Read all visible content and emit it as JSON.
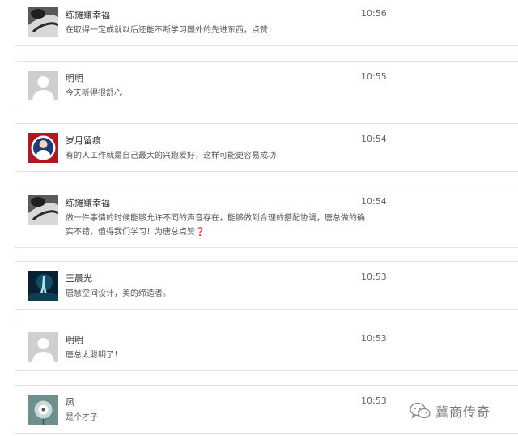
{
  "comments": [
    {
      "name": "练摊赚幸福",
      "time": "10:56",
      "text": "在取得一定成就以后还能不断学习国外的先进东西，点赞！",
      "avatar": "hand-photo-avatar"
    },
    {
      "name": "明明",
      "time": "10:55",
      "text": "今天听得很舒心",
      "avatar": "default-user-avatar"
    },
    {
      "name": "岁月留痕",
      "time": "10:54",
      "text": "有的人工作就是自己最大的兴趣爱好，这样可能更容易成功！",
      "avatar": "portrait-badge-avatar"
    },
    {
      "name": "练摊赚幸福",
      "time": "10:54",
      "text": "做一件事情的时候能够允许不同的声音存在，能够做到合理的搭配协调，唐总做的确实不错，值得我们学习！为唐总点赞",
      "emoji": "❓",
      "avatar": "hand-photo-avatar"
    },
    {
      "name": "王晨光",
      "time": "10:53",
      "text": "唐慧空间设计，美的缔造者。",
      "avatar": "blue-figure-avatar"
    },
    {
      "name": "明明",
      "time": "10:53",
      "text": "唐总太聪明了！",
      "avatar": "default-user-avatar"
    },
    {
      "name": "凤",
      "time": "10:53",
      "text": "是个才子",
      "avatar": "dandelion-avatar"
    }
  ],
  "watermark": {
    "text": "冀商传奇",
    "icon": "wechat-icon"
  },
  "colors": {
    "border": "#e3e3e3",
    "name": "#333333",
    "time": "#666666",
    "text": "#555555",
    "accent": "#c0262b"
  }
}
